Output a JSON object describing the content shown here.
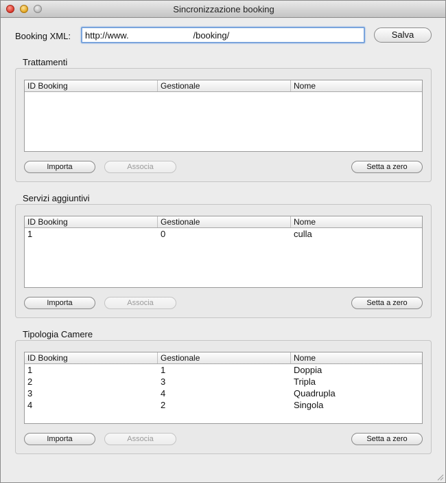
{
  "window": {
    "title": "Sincronizzazione booking"
  },
  "url_row": {
    "label": "Booking XML:",
    "value": "http://www.                          /booking/",
    "save_label": "Salva"
  },
  "sections": [
    {
      "title": "Trattamenti",
      "columns": [
        "ID Booking",
        "Gestionale",
        "Nome"
      ],
      "rows": [],
      "buttons": {
        "import": "Importa",
        "associate": "Associa",
        "reset": "Setta a zero"
      }
    },
    {
      "title": "Servizi aggiuntivi",
      "columns": [
        "ID Booking",
        "Gestionale",
        "Nome"
      ],
      "rows": [
        [
          "1",
          "0",
          "culla"
        ]
      ],
      "buttons": {
        "import": "Importa",
        "associate": "Associa",
        "reset": "Setta a zero"
      }
    },
    {
      "title": "Tipologia Camere",
      "columns": [
        "ID Booking",
        "Gestionale",
        "Nome"
      ],
      "rows": [
        [
          "1",
          "1",
          "Doppia"
        ],
        [
          "2",
          "3",
          "Tripla"
        ],
        [
          "3",
          "4",
          "Quadrupla"
        ],
        [
          "4",
          "2",
          "Singola"
        ]
      ],
      "buttons": {
        "import": "Importa",
        "associate": "Associa",
        "reset": "Setta a zero"
      }
    }
  ],
  "icons": [
    "close-icon",
    "minimize-icon",
    "zoom-icon",
    "resize-grip-icon"
  ]
}
